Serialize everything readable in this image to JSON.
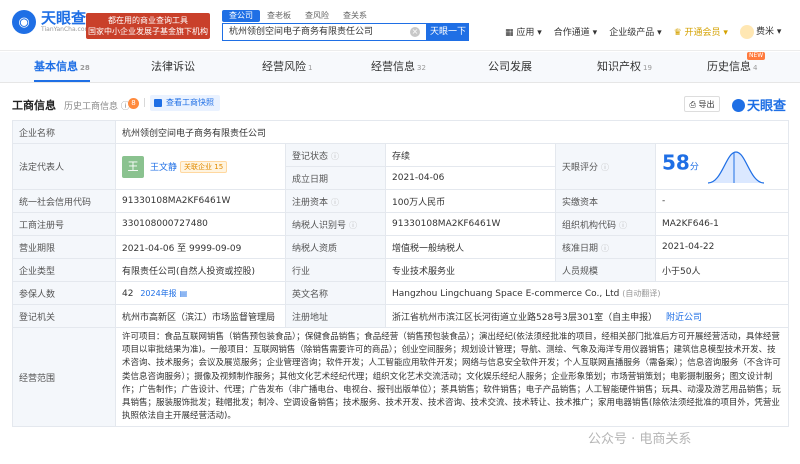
{
  "brand": {
    "name": "天眼查",
    "url": "TianYanCha.com",
    "slogan_l1": "都在用的商业查询工具",
    "slogan_l2": "国家中小企业发展子基金旗下机构"
  },
  "search": {
    "tabs": [
      "查公司",
      "查老板",
      "查风险",
      "查关系"
    ],
    "value": "杭州领创空间电子商务有限责任公司",
    "button": "天眼一下",
    "clear": "×"
  },
  "topnav": {
    "app": "应用",
    "partner": "合作通道",
    "enterprise": "企业级产品",
    "vip": "开通会员",
    "vip_icon": "♛",
    "user": "费米"
  },
  "tabs": [
    {
      "label": "基本信息",
      "count": "28"
    },
    {
      "label": "法律诉讼",
      "count": ""
    },
    {
      "label": "经营风险",
      "count": "1"
    },
    {
      "label": "经营信息",
      "count": "32"
    },
    {
      "label": "公司发展",
      "count": ""
    },
    {
      "label": "知识产权",
      "count": "19"
    },
    {
      "label": "历史信息",
      "count": "4"
    }
  ],
  "tab_new": "NEW",
  "section": {
    "title": "工商信息",
    "history": "历史工商信息",
    "history_count": "8",
    "report_button": "查看工商快照",
    "export_button": "导出",
    "brand": "天眼查"
  },
  "info": {
    "company_name_label": "企业名称",
    "company_name": "杭州领创空间电子商务有限责任公司",
    "legal_rep_label": "法定代表人",
    "legal_rep_avatar": "王",
    "legal_rep": "王文静",
    "legal_rep_badge": "关联企业 15",
    "status_label": "登记状态",
    "status": "存续",
    "score_label": "天眼评分",
    "score": "58",
    "score_unit": "分",
    "established_label": "成立日期",
    "established": "2021-04-06",
    "credit_code_label": "统一社会信用代码",
    "credit_code": "91330108MA2KF6461W",
    "reg_capital_label": "注册资本",
    "reg_capital": "100万人民币",
    "paid_capital_label": "实缴资本",
    "paid_capital": "-",
    "reg_no_label": "工商注册号",
    "reg_no": "330108000727480",
    "taxpayer_id_label": "纳税人识别号",
    "taxpayer_id": "91330108MA2KF6461W",
    "org_code_label": "组织机构代码",
    "org_code": "MA2KF646-1",
    "term_label": "营业期限",
    "term": "2021-04-06 至 9999-09-09",
    "tax_qual_label": "纳税人资质",
    "tax_qual": "增值税一般纳税人",
    "approval_label": "核准日期",
    "approval": "2021-04-22",
    "type_label": "企业类型",
    "type": "有限责任公司(自然人投资或控股)",
    "industry_label": "行业",
    "industry": "专业技术服务业",
    "staff_label": "人员规模",
    "staff": "小于50人",
    "insured_label": "参保人数",
    "insured": "42",
    "insured_note": "2024年报",
    "en_name_label": "英文名称",
    "en_name": "Hangzhou Lingchuang Space E-commerce Co., Ltd",
    "en_note": "(自动翻译)",
    "authority_label": "登记机关",
    "authority": "杭州市高新区（滨江）市场监督管理局",
    "address_label": "注册地址",
    "address": "浙江省杭州市滨江区长河街道立业路528号3层301室（自主申报）",
    "nearby": "附近公司",
    "scope_label": "经营范围",
    "scope": "许可项目：食品互联网销售（销售预包装食品）；保健食品销售；食品经营（销售预包装食品）；演出经纪(依法须经批准的项目，经相关部门批准后方可开展经营活动，具体经营项目以审批结果为准)。一般项目：互联网销售（除销售需要许可的商品）；创业空间服务；规划设计管理；导航、测绘、气象及海洋专用仪器销售；建筑信息模型技术开发、技术咨询、技术服务；会议及展览服务；企业管理咨询；软件开发；人工智能应用软件开发；网络与信息安全软件开发；个人互联网直播服务（需备案）；信息咨询服务（不含许可类信息咨询服务）；摄像及视频制作服务；其他文化艺术经纪代理；组织文化艺术交流活动；文化娱乐经纪人服务；企业形象策划；市场营销策划；电影摄制服务；图文设计制作；广告制作；广告设计、代理；广告发布（非广播电台、电视台、报刊出版单位）；茶具销售；软件销售；电子产品销售；人工智能硬件销售；玩具、动漫及游艺用品销售；玩具销售；服装服饰批发；鞋帽批发；制冷、空调设备销售；技术服务、技术开发、技术咨询、技术交流、技术转让、技术推广；家用电器销售(除依法须经批准的项目外，凭营业执照依法自主开展经营活动)。"
  },
  "watermark": "公众号 · 电商关系"
}
